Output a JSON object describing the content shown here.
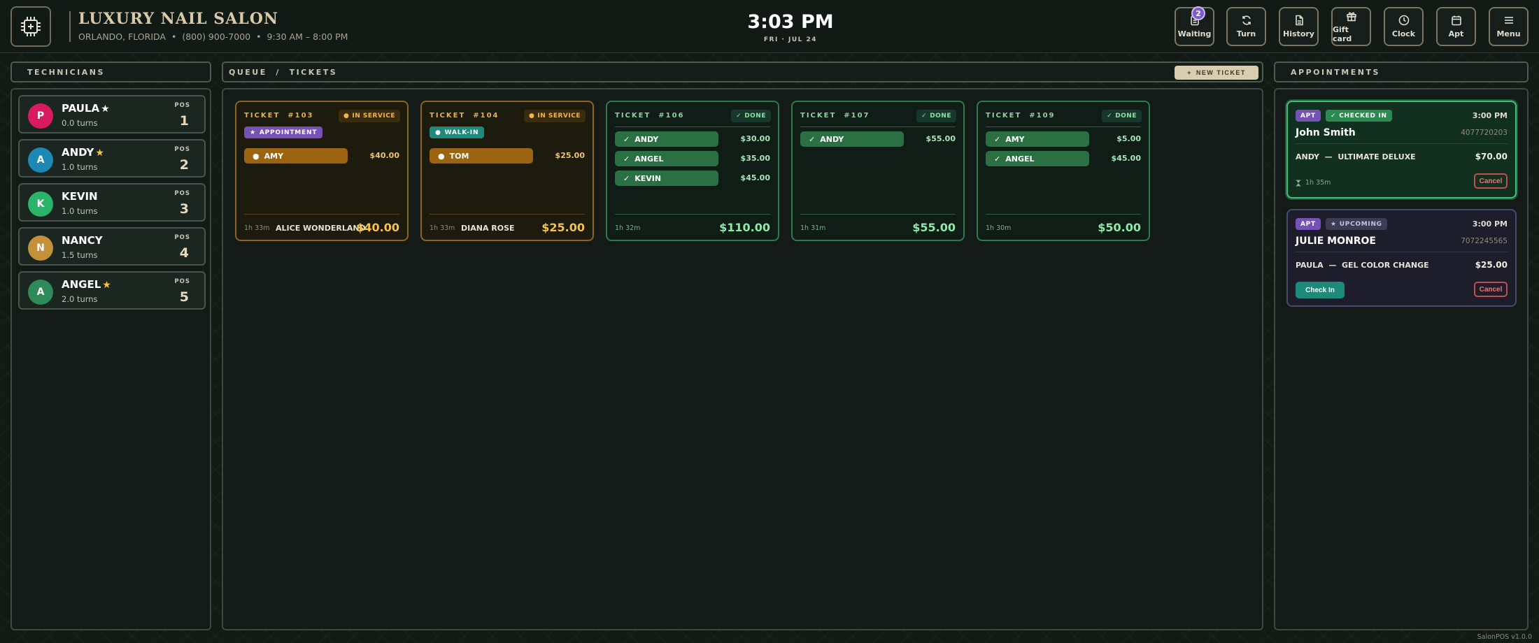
{
  "header": {
    "brand": "LUXURY NAIL SALON",
    "location": "ORLANDO, FLORIDA",
    "phone": "(800) 900-7000",
    "hours": "9:30 AM – 8:00 PM",
    "separator": "•",
    "time": "3:03 PM",
    "date": "FRI · JUL 24",
    "buttons": [
      {
        "label": "Waiting",
        "icon": "clipboard-icon",
        "badge": "2"
      },
      {
        "label": "Turn",
        "icon": "refresh-icon"
      },
      {
        "label": "History",
        "icon": "document-icon"
      },
      {
        "label": "Gift card",
        "icon": "gift-icon"
      },
      {
        "label": "Clock",
        "icon": "clock-icon"
      },
      {
        "label": "Apt",
        "icon": "calendar-icon"
      },
      {
        "label": "Menu",
        "icon": "hamburger-menu-icon"
      }
    ]
  },
  "technicians": {
    "title": "TECHNICIANS",
    "pos_label": "POS",
    "items": [
      {
        "initial": "P",
        "name": "PAULA",
        "star": "★",
        "turns": "0.0 turns",
        "pos": "1",
        "color": "#d81b60",
        "star_color": "#ffffff"
      },
      {
        "initial": "A",
        "name": "ANDY",
        "star": "★",
        "turns": "1.0 turns",
        "pos": "2",
        "color": "#1e88b5",
        "star_color": "#f5c542"
      },
      {
        "initial": "K",
        "name": "KEVIN",
        "star": "",
        "turns": "1.0 turns",
        "pos": "3",
        "color": "#2bb36a",
        "star_color": "#f5c542"
      },
      {
        "initial": "N",
        "name": "NANCY",
        "star": "",
        "turns": "1.5 turns",
        "pos": "4",
        "color": "#c4913a",
        "star_color": "#f5c542"
      },
      {
        "initial": "A",
        "name": "ANGEL",
        "star": "★",
        "turns": "2.0 turns",
        "pos": "5",
        "color": "#2e8b57",
        "star_color": "#f5c542"
      }
    ]
  },
  "queue": {
    "title": "QUEUE  /  TICKETS",
    "new_ticket": "NEW TICKET",
    "new_ticket_icon": "+",
    "tickets": [
      {
        "label": "TICKET  #103",
        "state": "service",
        "status": "IN SERVICE",
        "status_icon": "●",
        "type": "APPOINTMENT",
        "type_kind": "appt",
        "type_icon": "★",
        "services": [
          {
            "tech": "AMY",
            "price": "$40.00",
            "mark": "●"
          }
        ],
        "duration": "1h 33m",
        "customer": "ALICE WONDERLAND",
        "total": "$40.00"
      },
      {
        "label": "TICKET  #104",
        "state": "service",
        "status": "IN SERVICE",
        "status_icon": "●",
        "type": "WALK-IN",
        "type_kind": "walk",
        "type_icon": "●",
        "services": [
          {
            "tech": "TOM",
            "price": "$25.00",
            "mark": "●"
          }
        ],
        "duration": "1h 33m",
        "customer": "DIANA ROSE",
        "total": "$25.00"
      },
      {
        "label": "TICKET  #106",
        "state": "done",
        "status": "DONE",
        "status_icon": "✓",
        "services": [
          {
            "tech": "ANDY",
            "price": "$30.00",
            "mark": "✓"
          },
          {
            "tech": "ANGEL",
            "price": "$35.00",
            "mark": "✓"
          },
          {
            "tech": "KEVIN",
            "price": "$45.00",
            "mark": "✓"
          }
        ],
        "duration": "1h 32m",
        "customer": "",
        "total": "$110.00"
      },
      {
        "label": "TICKET  #107",
        "state": "done",
        "status": "DONE",
        "status_icon": "✓",
        "services": [
          {
            "tech": "ANDY",
            "price": "$55.00",
            "mark": "✓"
          }
        ],
        "duration": "1h 31m",
        "customer": "",
        "total": "$55.00"
      },
      {
        "label": "TICKET  #109",
        "state": "done",
        "status": "DONE",
        "status_icon": "✓",
        "services": [
          {
            "tech": "AMY",
            "price": "$5.00",
            "mark": "✓"
          },
          {
            "tech": "ANGEL",
            "price": "$45.00",
            "mark": "✓"
          }
        ],
        "duration": "1h 30m",
        "customer": "",
        "total": "$50.00"
      }
    ]
  },
  "appointments": {
    "title": "APPOINTMENTS",
    "items": [
      {
        "tag": "APT",
        "status": "CHECKED IN",
        "status_icon": "✓",
        "time": "3:00 PM",
        "name": "John Smith",
        "phone": "4077720203",
        "service": "ANDY  —  ULTIMATE DELUXE",
        "price": "$70.00",
        "duration": "1h 35m",
        "cancel": "Cancel"
      },
      {
        "tag": "APT",
        "status": "UPCOMING",
        "status_icon": "★",
        "time": "3:00 PM",
        "name": "JULIE MONROE",
        "phone": "7072245565",
        "service": "PAULA  —  GEL COLOR CHANGE",
        "price": "$25.00",
        "checkin": "Check In",
        "cancel": "Cancel"
      }
    ]
  },
  "footer": {
    "version": "SalonPOS v1.0.0"
  }
}
